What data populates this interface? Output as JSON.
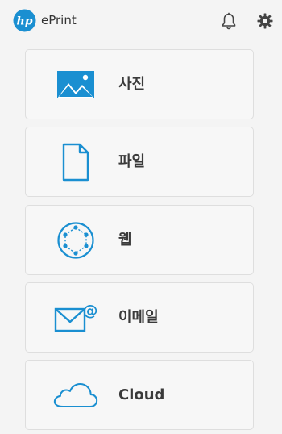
{
  "header": {
    "logo_text": "hp",
    "title": "ePrint",
    "icons": [
      "notification-bell-icon",
      "settings-gear-icon"
    ],
    "accent_color": "#1a8fd1"
  },
  "menu": {
    "items": [
      {
        "label": "사진",
        "icon": "photo-icon"
      },
      {
        "label": "파일",
        "icon": "file-icon"
      },
      {
        "label": "웹",
        "icon": "web-globe-icon"
      },
      {
        "label": "이메일",
        "icon": "email-icon"
      },
      {
        "label": "Cloud",
        "icon": "cloud-icon"
      }
    ]
  }
}
